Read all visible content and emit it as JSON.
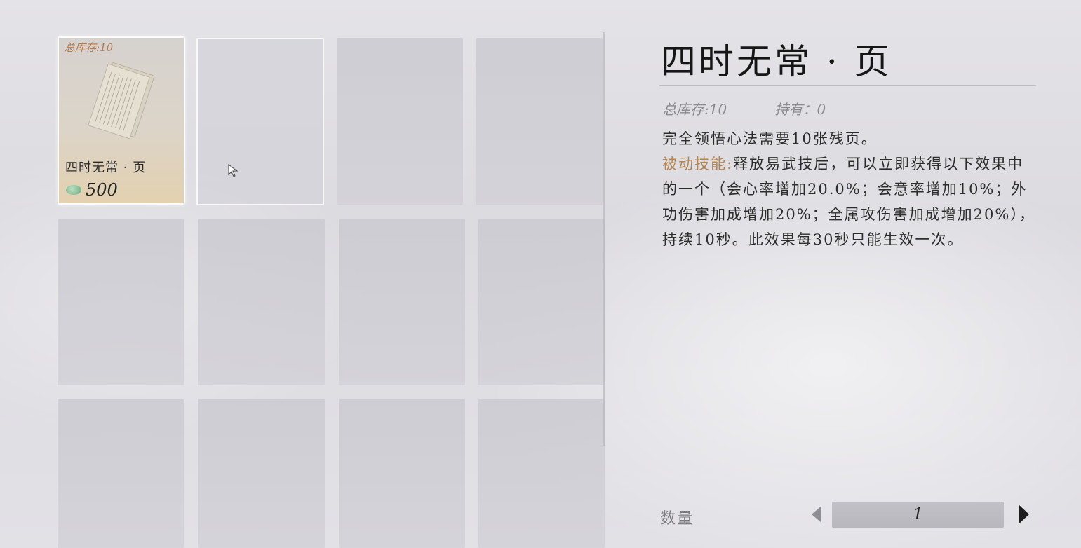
{
  "grid": {
    "slots": [
      {
        "stock": "总库存:10",
        "name": "四时无常 · 页",
        "price": "500",
        "selected": true
      },
      {},
      {},
      {},
      {},
      {},
      {},
      {},
      {},
      {},
      {},
      {}
    ]
  },
  "detail": {
    "title": "四时无常 · 页",
    "total_stock": "总库存:10",
    "held": "持有：0",
    "desc_line1": "完全领悟心法需要10张残页。",
    "passive_label": "被动技能:",
    "passive_text": "释放易武技后，可以立即获得以下效果中的一个（会心率增加20.0%；会意率增加10%；外功伤害加成增加20%；全属攻伤害加成增加20%），持续10秒。此效果每30秒只能生效一次。"
  },
  "quantity": {
    "label": "数量",
    "value": "1"
  },
  "colors": {
    "accent_passive": "#b5844f",
    "stock_tag": "#b57a4a"
  }
}
